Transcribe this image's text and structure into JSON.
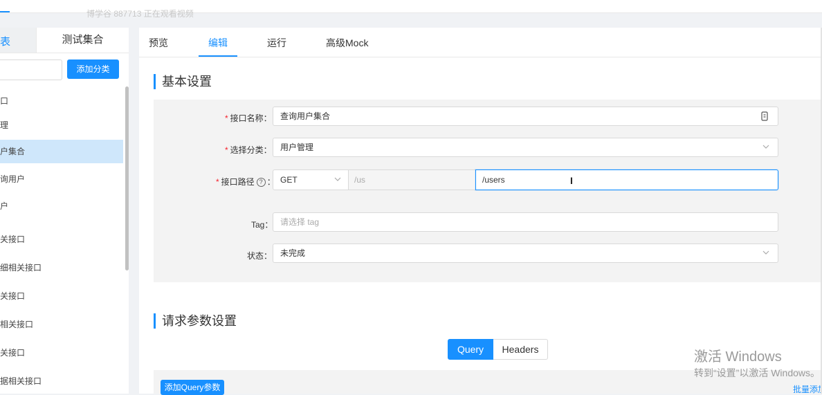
{
  "watermark": "博学谷 887713 正在观看视频",
  "sidebar": {
    "tab_list": "表",
    "tab_set": "测试集合",
    "add_category": "添加分类",
    "items": [
      {
        "label": "口",
        "active": false
      },
      {
        "label": "理",
        "active": false
      },
      {
        "label": "户集合",
        "active": true
      },
      {
        "label": "询用户",
        "active": false
      },
      {
        "label": "户",
        "active": false
      },
      {
        "label": "关接口",
        "active": false
      },
      {
        "label": "细相关接口",
        "active": false
      },
      {
        "label": "关接口",
        "active": false
      },
      {
        "label": "相关接口",
        "active": false
      },
      {
        "label": "关接口",
        "active": false
      },
      {
        "label": "据相关接口",
        "active": false
      }
    ]
  },
  "tabs": [
    {
      "label": "预览",
      "active": false
    },
    {
      "label": "编辑",
      "active": true
    },
    {
      "label": "运行",
      "active": false
    },
    {
      "label": "高级Mock",
      "active": false
    }
  ],
  "basic": {
    "title": "基本设置",
    "name_label": "接口名称：",
    "name_value": "查询用户集合",
    "category_label": "选择分类：",
    "category_value": "用户管理",
    "path_label": "接口路径",
    "path_colon": "：",
    "help_glyph": "?",
    "method": "GET",
    "path_prefix": "/us",
    "path_value": "/users",
    "tag_label": "Tag：",
    "tag_placeholder": "请选择 tag",
    "status_label": "状态：",
    "status_value": "未完成",
    "required_mark": "*"
  },
  "request": {
    "title": "请求参数设置",
    "seg_query": "Query",
    "seg_headers": "Headers",
    "add_query": "添加Query参数",
    "batch_add": "批量添加"
  },
  "overlay": {
    "line1": "激活 Windows",
    "line2": "转到“设置”以激活 Windows。"
  },
  "colors": {
    "accent": "#1890ff",
    "required": "#f5222d",
    "active_item_bg": "#cfe7fb"
  }
}
